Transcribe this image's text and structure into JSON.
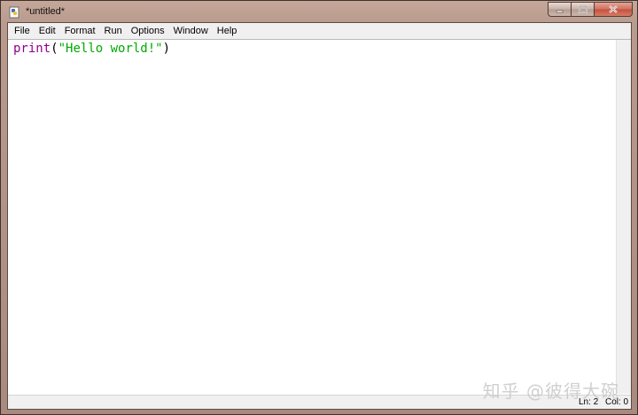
{
  "window": {
    "title": "*untitled*"
  },
  "menu": {
    "items": [
      "File",
      "Edit",
      "Format",
      "Run",
      "Options",
      "Window",
      "Help"
    ]
  },
  "editor": {
    "code_tokens": [
      {
        "text": "print",
        "kind": "builtin"
      },
      {
        "text": "(",
        "kind": "paren"
      },
      {
        "text": "\"Hello world!\"",
        "kind": "string"
      },
      {
        "text": ")",
        "kind": "paren"
      }
    ]
  },
  "statusbar": {
    "ln": "Ln: 2",
    "col": "Col: 0"
  },
  "watermark": {
    "text": "知乎 @彼得大碗"
  },
  "colors": {
    "builtin": "#900090",
    "string": "#00aa00",
    "frame": "#b99b8e"
  }
}
